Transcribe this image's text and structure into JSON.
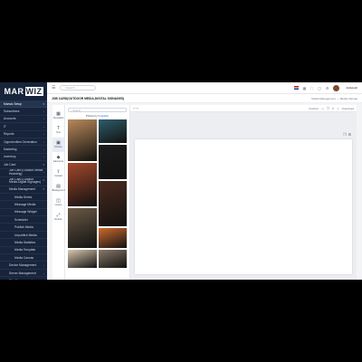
{
  "brand": {
    "part1": "MAR",
    "part2": "WIZ"
  },
  "sidebar": {
    "items": [
      {
        "label": "Marwiz Setup",
        "arrow": "▾",
        "active": true
      },
      {
        "label": "Subscribers",
        "arrow": "›"
      },
      {
        "label": "Accounts",
        "arrow": "›"
      },
      {
        "label": "IT",
        "arrow": "›"
      },
      {
        "label": "Reports",
        "arrow": "›"
      },
      {
        "label": "Opportunities Generation",
        "arrow": "›"
      },
      {
        "label": "Marketing",
        "arrow": "›"
      },
      {
        "label": "Inventory",
        "arrow": "›"
      },
      {
        "label": "Job Card",
        "arrow": "▾"
      },
      {
        "label": "Job Card (Outdoor Media Hoarding)",
        "arrow": "›",
        "sub": 1,
        "twoline": true
      },
      {
        "label": "Job Card (Outdoor Media-Digital Signages)",
        "arrow": "▾",
        "sub": 1,
        "twoline": true
      },
      {
        "label": "Media Management",
        "arrow": "▾",
        "sub": 1
      },
      {
        "label": "Media Series",
        "sub": 2
      },
      {
        "label": "Message Media",
        "sub": 2
      },
      {
        "label": "Message Widget",
        "sub": 2
      },
      {
        "label": "Scheduler",
        "sub": 2
      },
      {
        "label": "Publish Media",
        "sub": 2
      },
      {
        "label": "Unpublish Media",
        "sub": 2
      },
      {
        "label": "Media Statistics",
        "sub": 2
      },
      {
        "label": "Media Template",
        "sub": 2
      },
      {
        "label": "Media Canvas",
        "sub": 2
      },
      {
        "label": "Device Management",
        "arrow": "›",
        "sub": 1
      },
      {
        "label": "Server Management",
        "arrow": "›",
        "sub": 1
      },
      {
        "label": "Site Management",
        "arrow": "›",
        "sub": 1
      },
      {
        "label": "Reports",
        "arrow": "›"
      }
    ]
  },
  "topbar": {
    "search_placeholder": "Search...",
    "user_name": "Ashutosh"
  },
  "page": {
    "title": "JOB CARD(OUTDOOR MEDIA-DIGITAL SIGNAGES)",
    "breadcrumb": [
      "Media Management",
      "›",
      "Media Canvas"
    ]
  },
  "tools": [
    {
      "icon": "▦",
      "label": "Templates"
    },
    {
      "icon": "T",
      "label": "Text"
    },
    {
      "icon": "▣",
      "label": "Photos",
      "active": true
    },
    {
      "icon": "◆",
      "label": "Elements"
    },
    {
      "icon": "⇪",
      "label": "Upload"
    },
    {
      "icon": "▤",
      "label": "Background"
    },
    {
      "icon": "◫",
      "label": "Layers"
    },
    {
      "icon": "⤢",
      "label": "Resize"
    }
  ],
  "photos_panel": {
    "search_placeholder": "Search...",
    "heading_prefix": "Photos by",
    "heading_link": "Unsplash",
    "left_column": [
      "#b8895a",
      "#a3482b",
      "#6b5a46",
      "#d8c7ad"
    ],
    "right_column": [
      "#2f5d6b",
      "#1c1c1c",
      "#4a2a1e",
      "#cc6a2e",
      "#8a7a6a"
    ]
  },
  "canvas": {
    "position_label": "Position",
    "download_label": "Download"
  }
}
